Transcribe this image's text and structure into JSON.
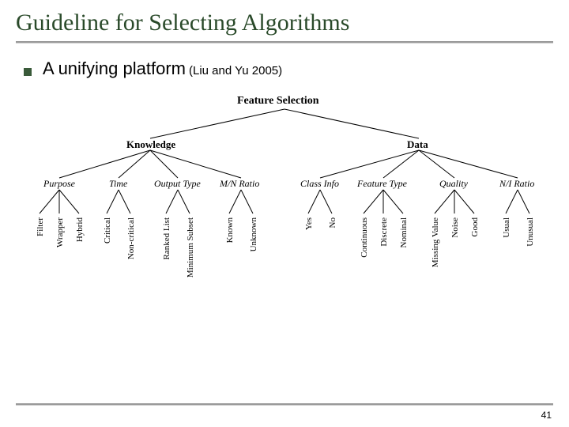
{
  "title": "Guideline for Selecting Algorithms",
  "bullet": {
    "text": "A unifying platform",
    "cite": "(Liu and Yu 2005)"
  },
  "tree": {
    "root": "Feature Selection",
    "branches": [
      {
        "name": "Knowledge",
        "categories": [
          {
            "name": "Purpose",
            "leaves": [
              "Filter",
              "Wrapper",
              "Hybrid"
            ]
          },
          {
            "name": "Time",
            "leaves": [
              "Critical",
              "Non-critical"
            ]
          },
          {
            "name": "Output Type",
            "leaves": [
              "Ranked List",
              "Minimum Subset"
            ]
          },
          {
            "name": "M/N Ratio",
            "leaves": [
              "Known",
              "Unknown"
            ]
          }
        ]
      },
      {
        "name": "Data",
        "categories": [
          {
            "name": "Class Info",
            "leaves": [
              "Yes",
              "No"
            ]
          },
          {
            "name": "Feature Type",
            "leaves": [
              "Continuous",
              "Discrete",
              "Nominal"
            ]
          },
          {
            "name": "Quality",
            "leaves": [
              "Missing Value",
              "Noise",
              "Good"
            ]
          },
          {
            "name": "N/I Ratio",
            "leaves": [
              "Usual",
              "Unusual"
            ]
          }
        ]
      }
    ]
  },
  "page": "41"
}
